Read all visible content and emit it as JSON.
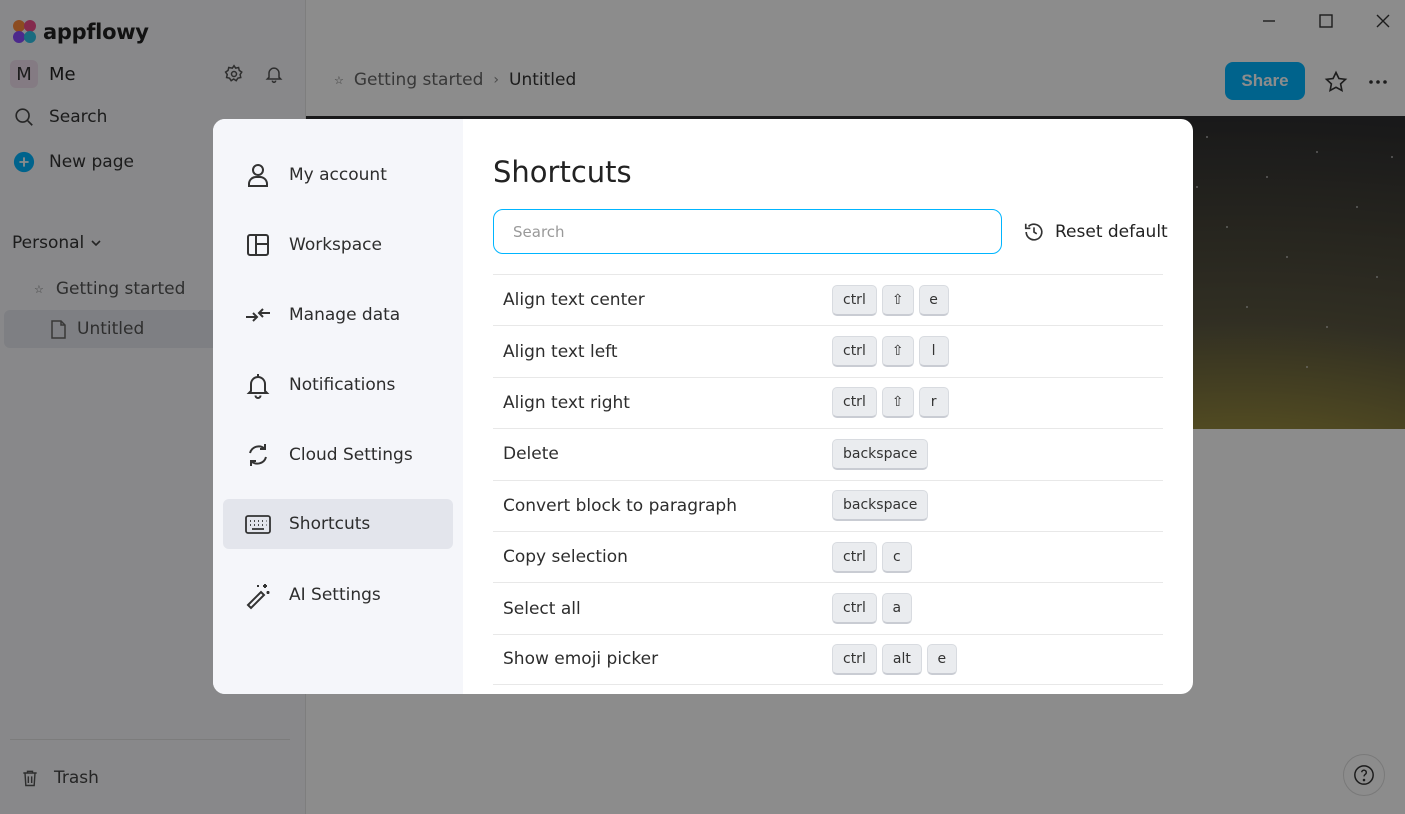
{
  "app": {
    "logo_text": "appflowy"
  },
  "sidebar": {
    "user": {
      "avatar_letter": "M",
      "name": "Me"
    },
    "search_label": "Search",
    "new_page_label": "New page",
    "section_title": "Personal",
    "pages": [
      {
        "label": "Getting started",
        "icon": "star"
      },
      {
        "label": "Untitled",
        "icon": "document"
      }
    ],
    "trash_label": "Trash"
  },
  "topbar": {
    "breadcrumb": [
      "Getting started",
      "Untitled"
    ],
    "share_label": "Share"
  },
  "settings": {
    "menu": [
      {
        "label": "My account",
        "icon": "person-icon"
      },
      {
        "label": "Workspace",
        "icon": "layout-icon"
      },
      {
        "label": "Manage data",
        "icon": "arrows-in-icon"
      },
      {
        "label": "Notifications",
        "icon": "bell-icon"
      },
      {
        "label": "Cloud Settings",
        "icon": "sync-icon"
      },
      {
        "label": "Shortcuts",
        "icon": "keyboard-icon"
      },
      {
        "label": "AI Settings",
        "icon": "magic-wand-icon"
      }
    ],
    "active_menu": "Shortcuts",
    "shortcuts": {
      "title": "Shortcuts",
      "search_placeholder": "Search",
      "reset_label": "Reset default",
      "rows": [
        {
          "label": "Align text center",
          "keys": [
            "ctrl",
            "⇧",
            "e"
          ]
        },
        {
          "label": "Align text left",
          "keys": [
            "ctrl",
            "⇧",
            "l"
          ]
        },
        {
          "label": "Align text right",
          "keys": [
            "ctrl",
            "⇧",
            "r"
          ]
        },
        {
          "label": "Delete",
          "keys": [
            "backspace"
          ]
        },
        {
          "label": "Convert block to paragraph",
          "keys": [
            "backspace"
          ]
        },
        {
          "label": "Copy selection",
          "keys": [
            "ctrl",
            "c"
          ]
        },
        {
          "label": "Select all",
          "keys": [
            "ctrl",
            "a"
          ]
        },
        {
          "label": "Show emoji picker",
          "keys": [
            "ctrl",
            "alt",
            "e"
          ]
        }
      ]
    }
  },
  "colors": {
    "accent": "#00b5ff",
    "overlay": "rgba(0,0,0,0.45)"
  }
}
